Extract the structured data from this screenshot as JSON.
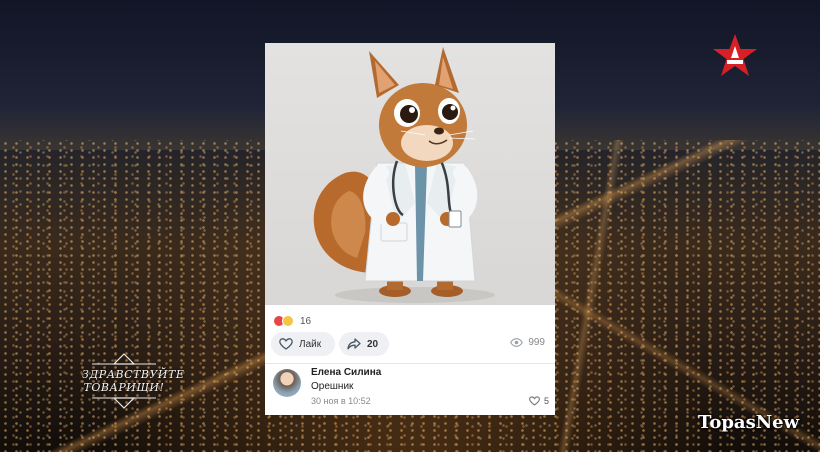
{
  "broadcast": {
    "show_logo_line1": "ЗДРАВСТВУЙТЕ",
    "show_logo_line2": "ТОВАРИЩИ!",
    "watermark": "TopasNew"
  },
  "post": {
    "reactions_count": "16",
    "like_label": "Лайк",
    "share_count": "20",
    "views_count": "999",
    "comment": {
      "author": "Елена Силина",
      "text": "Орешник",
      "time": "30 ноя в 10:52",
      "likes": "5"
    }
  },
  "colors": {
    "channel_red": "#d71f26",
    "reaction_heart": "#e64646",
    "reaction_laugh": "#f6c443"
  },
  "icons": [
    "star-channel-logo",
    "heart-icon",
    "share-arrow-icon",
    "eye-icon",
    "squirrel-illustration"
  ]
}
